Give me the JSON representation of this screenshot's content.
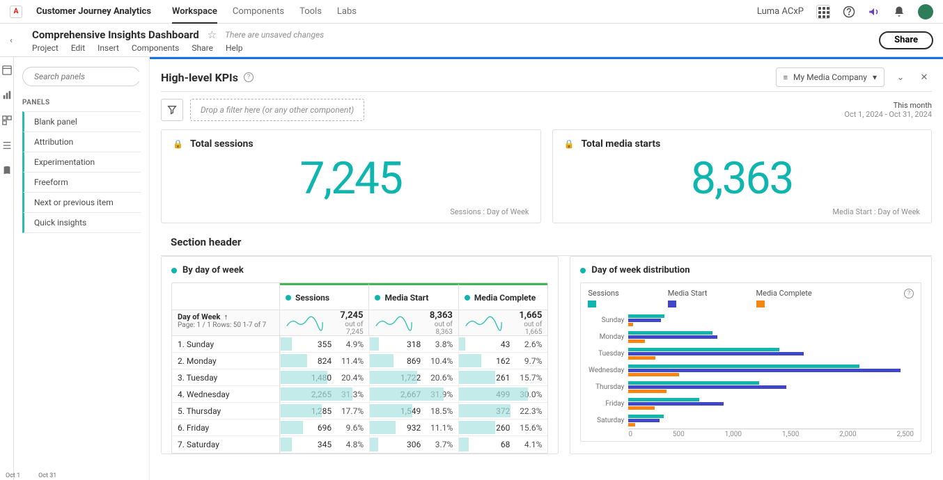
{
  "topbar": {
    "app_name": "Customer Journey Analytics",
    "tabs": [
      "Workspace",
      "Components",
      "Tools",
      "Labs"
    ],
    "active_tab": 0,
    "org_name": "Luma ACxP"
  },
  "project": {
    "title": "Comprehensive Insights Dashboard",
    "unsaved": "There are unsaved changes",
    "menus": [
      "Project",
      "Edit",
      "Insert",
      "Components",
      "Share",
      "Help"
    ],
    "share_label": "Share"
  },
  "left": {
    "search_placeholder": "Search panels",
    "section_label": "PANELS",
    "panel_items": [
      "Blank panel",
      "Attribution",
      "Experimentation",
      "Freeform",
      "Next or previous item",
      "Quick insights"
    ]
  },
  "panel": {
    "title": "High-level KPIs",
    "data_view": "My Media Company",
    "daterange_label": "This month",
    "daterange": "Oct 1, 2024 - Oct 31, 2024",
    "dropzone": "Drop a filter here (or any other component)"
  },
  "kpis": [
    {
      "title": "Total sessions",
      "value": "7,245",
      "footer": "Sessions : Day of Week"
    },
    {
      "title": "Total media starts",
      "value": "8,363",
      "footer": "Media Start : Day of Week"
    }
  ],
  "section_header": "Section header",
  "table": {
    "title": "By day of week",
    "dim_label": "Day of Week",
    "page_info": "Page: 1 / 1  Rows:  50   1-7 of 7",
    "spark_range_left": "Oct 1",
    "spark_range_right": "Oct 31",
    "metrics": [
      {
        "name": "Sessions",
        "total": "7,245",
        "sub": "out of 7,245"
      },
      {
        "name": "Media Start",
        "total": "8,363",
        "sub": "out of 8,363"
      },
      {
        "name": "Media Complete",
        "total": "1,665",
        "sub": "out of 1,665"
      }
    ],
    "rows": [
      {
        "label": "1.  Sunday",
        "cells": [
          {
            "v": "355",
            "p": "4.9%",
            "w": 4.9
          },
          {
            "v": "318",
            "p": "3.8%",
            "w": 3.8
          },
          {
            "v": "43",
            "p": "2.6%",
            "w": 2.6
          }
        ]
      },
      {
        "label": "2.  Monday",
        "cells": [
          {
            "v": "824",
            "p": "11.4%",
            "w": 11.4
          },
          {
            "v": "869",
            "p": "10.4%",
            "w": 10.4
          },
          {
            "v": "162",
            "p": "9.7%",
            "w": 9.7
          }
        ]
      },
      {
        "label": "3.  Tuesday",
        "cells": [
          {
            "v": "1,480",
            "p": "20.4%",
            "w": 20.4
          },
          {
            "v": "1,722",
            "p": "20.6%",
            "w": 20.6
          },
          {
            "v": "261",
            "p": "15.7%",
            "w": 15.7
          }
        ]
      },
      {
        "label": "4.  Wednesday",
        "cells": [
          {
            "v": "2,265",
            "p": "31.3%",
            "w": 31.3
          },
          {
            "v": "2,667",
            "p": "31.9%",
            "w": 31.9
          },
          {
            "v": "499",
            "p": "30.0%",
            "w": 30.0
          }
        ]
      },
      {
        "label": "5.  Thursday",
        "cells": [
          {
            "v": "1,285",
            "p": "17.7%",
            "w": 17.7
          },
          {
            "v": "1,549",
            "p": "18.5%",
            "w": 18.5
          },
          {
            "v": "372",
            "p": "22.3%",
            "w": 22.3
          }
        ]
      },
      {
        "label": "6.  Friday",
        "cells": [
          {
            "v": "696",
            "p": "9.6%",
            "w": 9.6
          },
          {
            "v": "932",
            "p": "11.1%",
            "w": 11.1
          },
          {
            "v": "260",
            "p": "15.6%",
            "w": 15.6
          }
        ]
      },
      {
        "label": "7.  Saturday",
        "cells": [
          {
            "v": "345",
            "p": "4.8%",
            "w": 4.8
          },
          {
            "v": "306",
            "p": "3.7%",
            "w": 3.7
          },
          {
            "v": "68",
            "p": "4.1%",
            "w": 4.1
          }
        ]
      }
    ]
  },
  "chart_data": {
    "type": "bar",
    "title": "Day of week distribution",
    "series": [
      {
        "name": "Sessions",
        "color": "#0fb5ae"
      },
      {
        "name": "Media Start",
        "color": "#4046ca"
      },
      {
        "name": "Media Complete",
        "color": "#f68511"
      }
    ],
    "categories": [
      "Sunday",
      "Monday",
      "Tuesday",
      "Wednesday",
      "Thursday",
      "Friday",
      "Saturday"
    ],
    "values": {
      "Sessions": [
        355,
        824,
        1480,
        2265,
        1285,
        696,
        345
      ],
      "Media Start": [
        318,
        869,
        1722,
        2667,
        1549,
        932,
        306
      ],
      "Media Complete": [
        43,
        162,
        261,
        499,
        372,
        260,
        68
      ]
    },
    "xlim": [
      0,
      2800
    ],
    "ticks": [
      0,
      500,
      1000,
      1500,
      2000,
      2500
    ]
  }
}
